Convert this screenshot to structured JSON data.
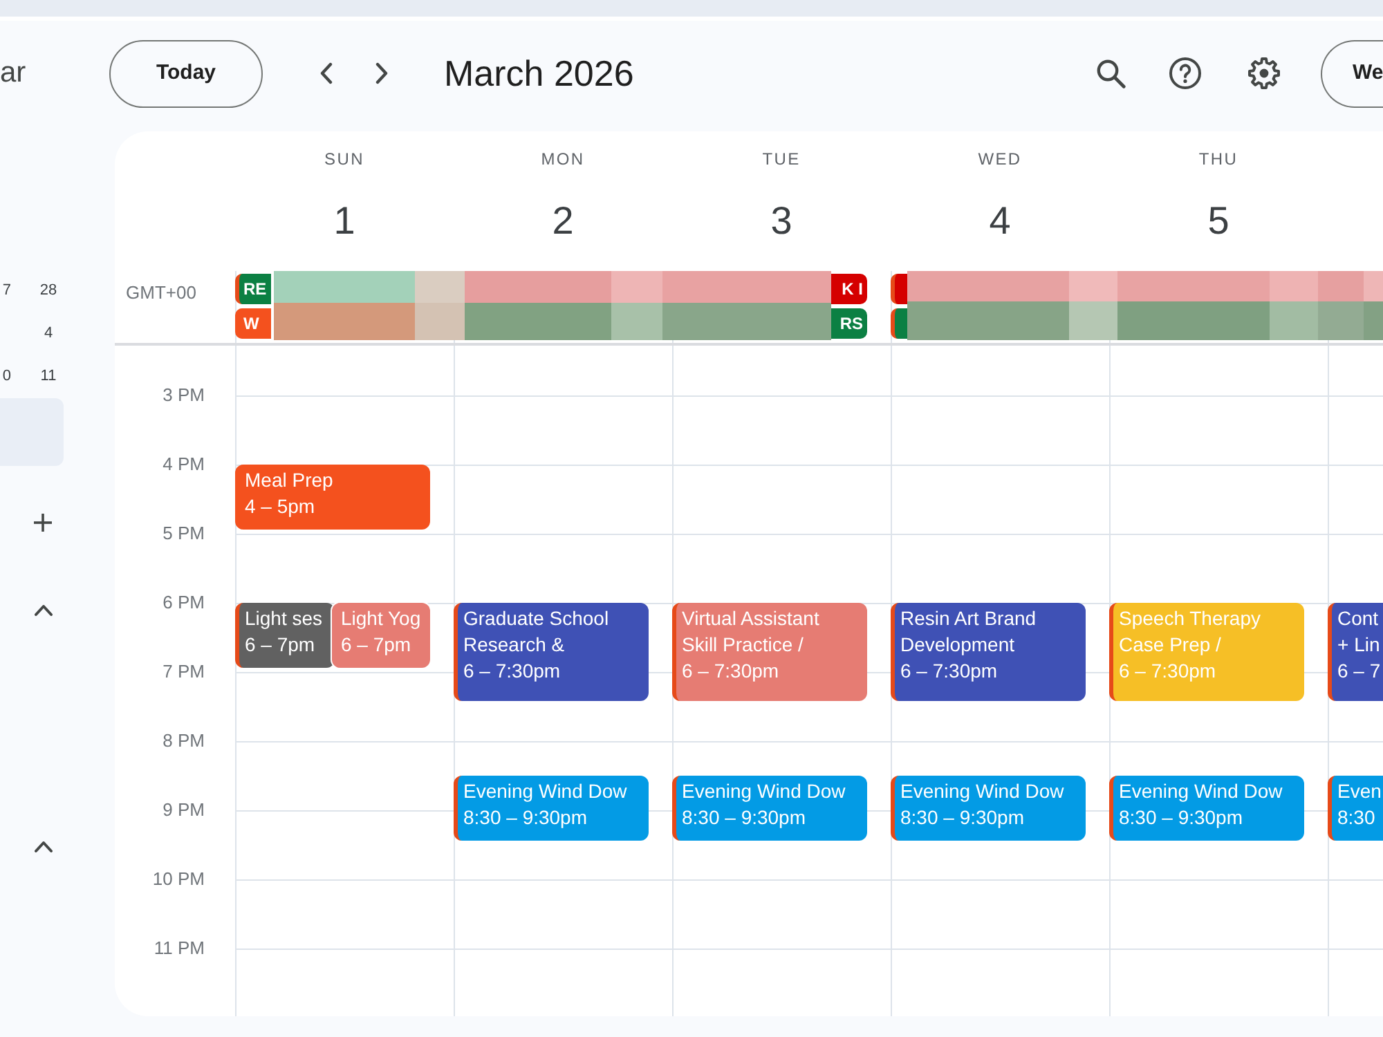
{
  "header": {
    "app_name": "ar",
    "today": "Today",
    "period": "March 2026",
    "view": "We"
  },
  "sidebar": {
    "mini_calendar": [
      {
        "column_1": "7",
        "column_2": "28"
      },
      {
        "column_2": "4"
      },
      {
        "column_1": "0",
        "column_2": "11"
      }
    ],
    "sections": [
      {
        "expanded": true
      },
      {
        "expanded": true
      }
    ]
  },
  "timezone": "GMT+00",
  "days": [
    {
      "name": "SUN",
      "number": "1",
      "all_day": [
        {
          "text": "RE",
          "end_shown": false,
          "color": "#0b8043",
          "stripe": true
        },
        {
          "text": "W",
          "end_shown": false,
          "color": "#f4511e",
          "stripe": false
        }
      ]
    },
    {
      "name": "MON",
      "number": "2"
    },
    {
      "name": "TUE",
      "number": "3",
      "all_day": [
        {
          "text": "K I",
          "end_shown": true,
          "color": "#d50000"
        },
        {
          "text": "RS",
          "end_shown": true,
          "color": "#0b8043"
        }
      ]
    },
    {
      "name": "WED",
      "number": "4",
      "all_day": [
        {
          "color": "#d50000",
          "stripe": true
        },
        {
          "color": "#0b8043",
          "stripe": true
        }
      ]
    },
    {
      "name": "THU",
      "number": "5"
    }
  ],
  "rows": [
    {
      "label": "3 PM"
    },
    {
      "label": "4 PM",
      "cells": [
        {
          "events": [
            {
              "title": "Meal Prep",
              "time": "4 – 5pm",
              "color": "#f4511e",
              "stripe": false,
              "starts_half_past": false,
              "ninety_minutes": false
            }
          ]
        },
        {},
        {},
        {},
        {},
        {}
      ]
    },
    {
      "label": "5 PM"
    },
    {
      "label": "6 PM",
      "cells": [
        {
          "events": [
            {
              "title": "Light ses",
              "time": "6 – 7pm",
              "color": "#616161",
              "stripe": true,
              "starts_half_past": false,
              "ninety_minutes": false
            },
            {
              "title": "Light Yog",
              "time": "6 – 7pm",
              "color": "#e67c73",
              "stripe": false,
              "starts_half_past": false,
              "ninety_minutes": false
            }
          ]
        },
        {
          "events": [
            {
              "title": "Graduate School Research &",
              "time": "6 – 7:30pm",
              "color": "#3f51b5",
              "stripe": true,
              "starts_half_past": false,
              "ninety_minutes": true
            }
          ]
        },
        {
          "events": [
            {
              "title": "Virtual Assistant Skill Practice /",
              "time": "6 – 7:30pm",
              "color": "#e67c73",
              "stripe": true,
              "starts_half_past": false,
              "ninety_minutes": true
            }
          ]
        },
        {
          "events": [
            {
              "title": "Resin Art Brand Development",
              "time": "6 – 7:30pm",
              "color": "#3f51b5",
              "stripe": true,
              "starts_half_past": false,
              "ninety_minutes": true
            }
          ]
        },
        {
          "events": [
            {
              "title": "Speech Therapy Case Prep /",
              "time": "6 – 7:30pm",
              "color": "#f6bf26",
              "stripe": true,
              "starts_half_past": false,
              "ninety_minutes": true
            }
          ]
        },
        {
          "events": [
            {
              "title": "Cont + Lin",
              "time": "6 – 7",
              "color": "#3f51b5",
              "stripe": true,
              "starts_half_past": false,
              "ninety_minutes": true
            }
          ]
        }
      ]
    },
    {
      "label": "7 PM"
    },
    {
      "label": "8 PM",
      "cells": [
        {},
        {
          "events": [
            {
              "title": "Evening Wind Dow",
              "time": "8:30 – 9:30pm",
              "color": "#039be5",
              "stripe": true,
              "starts_half_past": true,
              "ninety_minutes": false
            }
          ]
        },
        {
          "events": [
            {
              "title": "Evening Wind Dow",
              "time": "8:30 – 9:30pm",
              "color": "#039be5",
              "stripe": true,
              "starts_half_past": true,
              "ninety_minutes": false
            }
          ]
        },
        {
          "events": [
            {
              "title": "Evening Wind Dow",
              "time": "8:30 – 9:30pm",
              "color": "#039be5",
              "stripe": true,
              "starts_half_past": true,
              "ninety_minutes": false
            }
          ]
        },
        {
          "events": [
            {
              "title": "Evening Wind Dow",
              "time": "8:30 – 9:30pm",
              "color": "#039be5",
              "stripe": true,
              "starts_half_past": true,
              "ninety_minutes": false
            }
          ]
        },
        {
          "events": [
            {
              "title": "Even",
              "time": "8:30",
              "color": "#039be5",
              "stripe": true,
              "starts_half_past": true,
              "ninety_minutes": false
            }
          ]
        }
      ]
    },
    {
      "label": "9 PM"
    },
    {
      "label": "10 PM"
    },
    {
      "label": "11 PM"
    }
  ]
}
